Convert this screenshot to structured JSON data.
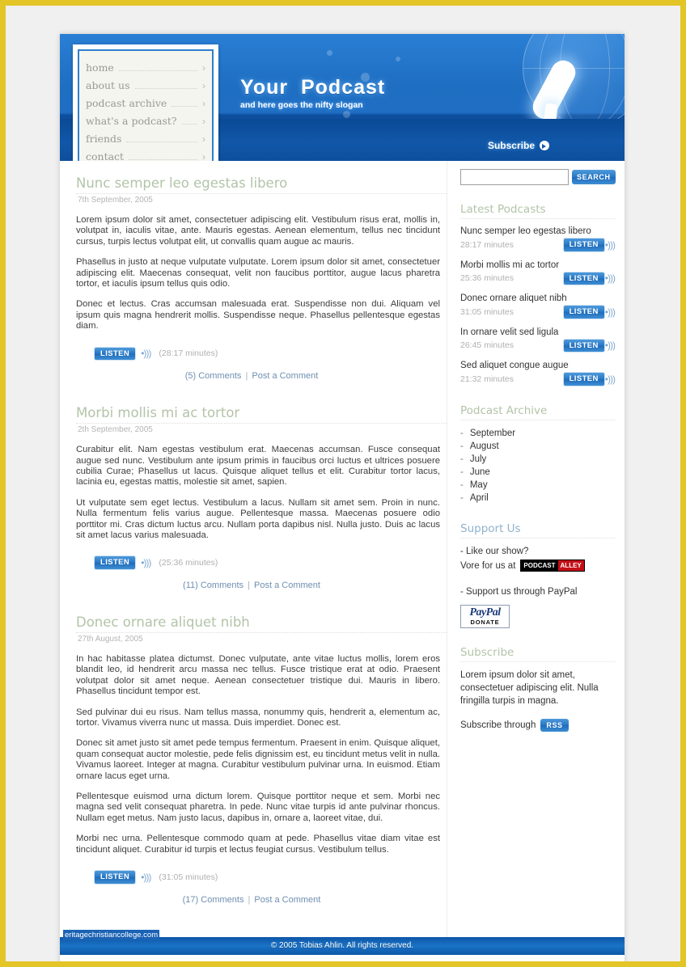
{
  "site": {
    "brand_title": "Your  Podcast",
    "slogan": "and here goes the nifty slogan",
    "subscribe_label": "Subscribe"
  },
  "nav": {
    "items": [
      {
        "label": "home"
      },
      {
        "label": "about us"
      },
      {
        "label": "podcast archive"
      },
      {
        "label": "what's a podcast?"
      },
      {
        "label": "friends"
      },
      {
        "label": "contact"
      }
    ],
    "arrow": "›"
  },
  "search": {
    "value": "",
    "placeholder": "",
    "button_label": "SEARCH"
  },
  "posts": [
    {
      "title": "Nunc semper leo egestas libero",
      "date": "7th September, 2005",
      "paragraphs": [
        "Lorem ipsum dolor sit amet, consectetuer adipiscing elit. Vestibulum risus erat, mollis in, volutpat in, iaculis vitae, ante. Mauris egestas. Aenean elementum, tellus nec tincidunt cursus, turpis lectus volutpat elit, ut convallis quam augue ac mauris.",
        "Phasellus in justo at neque vulputate vulputate. Lorem ipsum dolor sit amet, consectetuer adipiscing elit. Maecenas consequat, velit non faucibus porttitor, augue lacus pharetra tortor, et iaculis ipsum tellus quis odio.",
        "Donec et lectus. Cras accumsan malesuada erat. Suspendisse non dui. Aliquam vel ipsum quis magna hendrerit mollis. Suspendisse neque. Phasellus pellentesque egestas diam."
      ],
      "listen_label": "LISTEN",
      "duration": "(28:17 minutes)",
      "comments_count": "(5) Comments",
      "post_comment": "Post a Comment"
    },
    {
      "title": "Morbi mollis mi ac tortor",
      "date": "2th September, 2005",
      "paragraphs": [
        "Curabitur elit. Nam egestas vestibulum erat. Maecenas accumsan. Fusce consequat augue sed nunc. Vestibulum ante ipsum primis in faucibus orci luctus et ultrices posuere cubilia Curae; Phasellus ut lacus. Quisque aliquet tellus et elit. Curabitur tortor lacus, lacinia eu, egestas mattis, molestie sit amet, sapien.",
        "Ut vulputate sem eget lectus. Vestibulum a lacus. Nullam sit amet sem. Proin in nunc. Nulla fermentum felis varius augue. Pellentesque massa. Maecenas posuere odio porttitor mi. Cras dictum luctus arcu. Nullam porta dapibus nisl. Nulla justo. Duis ac lacus sit amet lacus varius malesuada."
      ],
      "listen_label": "LISTEN",
      "duration": "(25:36 minutes)",
      "comments_count": "(11) Comments",
      "post_comment": "Post a Comment"
    },
    {
      "title": "Donec ornare aliquet nibh",
      "date": "27th August, 2005",
      "paragraphs": [
        "In hac habitasse platea dictumst. Donec vulputate, ante vitae luctus mollis, lorem eros blandit leo, id hendrerit arcu massa nec tellus. Fusce tristique erat at odio. Praesent volutpat dolor sit amet neque. Aenean consectetuer tristique dui. Mauris in libero. Phasellus tincidunt tempor est.",
        "Sed pulvinar dui eu risus. Nam tellus massa, nonummy quis, hendrerit a, elementum ac, tortor. Vivamus viverra nunc ut massa. Duis imperdiet. Donec est.",
        "Donec sit amet justo sit amet pede tempus fermentum. Praesent in enim. Quisque aliquet, quam consequat auctor molestie, pede felis dignissim est, eu tincidunt metus velit in nulla. Vivamus laoreet. Integer at magna. Curabitur vestibulum pulvinar urna. In euismod. Etiam ornare lacus eget urna.",
        "Pellentesque euismod urna dictum lorem. Quisque porttitor neque et sem. Morbi nec magna sed velit consequat pharetra. In pede. Nunc vitae turpis id ante pulvinar rhoncus. Nullam eget metus. Nam justo lacus, dapibus in, ornare a, laoreet vitae, dui.",
        "Morbi nec urna. Pellentesque commodo quam at pede. Phasellus vitae diam vitae est tincidunt aliquet. Curabitur id turpis et lectus feugiat cursus. Vestibulum tellus."
      ],
      "listen_label": "LISTEN",
      "duration": "(31:05 minutes)",
      "comments_count": "(17) Comments",
      "post_comment": "Post a Comment"
    }
  ],
  "sidebar": {
    "latest_heading": "Latest Podcasts",
    "latest": [
      {
        "name": "Nunc semper leo egestas libero",
        "duration": "28:17 minutes",
        "listen_label": "LISTEN"
      },
      {
        "name": "Morbi mollis mi ac tortor",
        "duration": "25:36 minutes",
        "listen_label": "LISTEN"
      },
      {
        "name": "Donec ornare aliquet nibh",
        "duration": "31:05 minutes",
        "listen_label": "LISTEN"
      },
      {
        "name": "In ornare velit sed ligula",
        "duration": "26:45 minutes",
        "listen_label": "LISTEN"
      },
      {
        "name": "Sed aliquet congue augue",
        "duration": "21:32 minutes",
        "listen_label": "LISTEN"
      }
    ],
    "archive_heading": "Podcast Archive",
    "archive": [
      {
        "label": "September"
      },
      {
        "label": "August"
      },
      {
        "label": "July"
      },
      {
        "label": "June"
      },
      {
        "label": "May"
      },
      {
        "label": "April"
      }
    ],
    "support_heading": "Support Us",
    "support_line1": "- Like our show?",
    "support_line2": "Vore for us at",
    "podcast_alley_left": "PODCAST",
    "podcast_alley_right": "ALLEY",
    "support_line3": "- Support us through PayPal",
    "paypal_top": "PayPal",
    "paypal_bottom": "DONATE",
    "subscribe_heading": "Subscribe",
    "subscribe_text": "Lorem ipsum dolor sit amet, consectetuer adipiscing elit. Nulla fringilla turpis in magna.",
    "subscribe_through": "Subscribe through",
    "rss_label": "RSS"
  },
  "footer": {
    "left_text": "eritagechristiancollege.com",
    "copyright": "© 2005 Tobias Ahlin. All rights reserved."
  },
  "colors": {
    "accent_blue": "#1f6cba",
    "heading_green": "#b2c4a8",
    "frame_gold": "#e3c528",
    "link_blue": "#6f8fb0",
    "alley_red": "#c40f17"
  }
}
